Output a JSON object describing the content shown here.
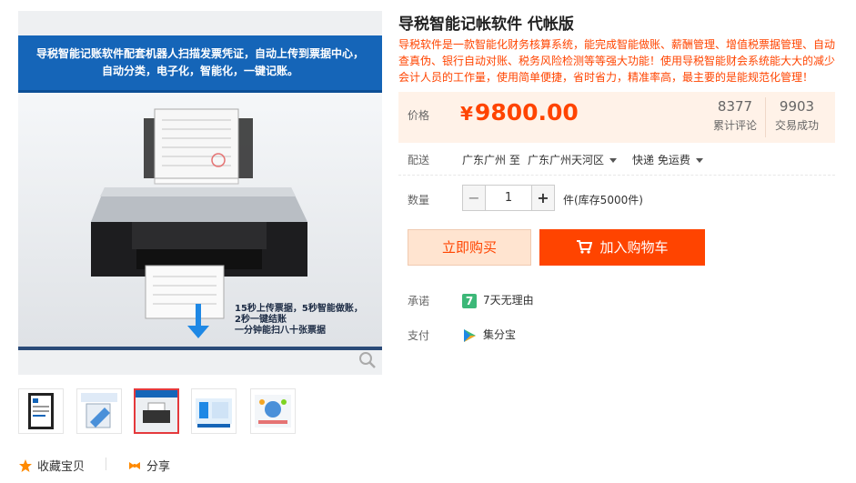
{
  "image": {
    "banner_line1": "导税智能记账软件配套机器人扫描发票凭证，自动上传到票据中心，",
    "banner_line2": "自动分类，电子化，智能化，一键记账。",
    "caption": [
      "15秒上传票据，5秒智能做账，",
      "2秒一键结账",
      "一分钟能扫八十张票据"
    ]
  },
  "thumbnails": [
    "thumb-1",
    "thumb-2",
    "thumb-3",
    "thumb-4",
    "thumb-5"
  ],
  "actions": {
    "favorite_label": "收藏宝贝",
    "share_label": "分享"
  },
  "product": {
    "title": "导税智能记帐软件 代帐版",
    "description": "导税软件是一款智能化财务核算系统，能完成智能做账、薪酬管理、增值税票据管理、自动查真伪、银行自动对账、税务风险检测等等强大功能！使用导税智能财会系统能大大的减少会计人员的工作量，使用简单便捷，省时省力，精准率高，最主要的是能规范化管理！"
  },
  "price": {
    "label": "价格",
    "currency": "¥",
    "value": "9800.00",
    "reviews_count": "8377",
    "reviews_label": "累计评论",
    "deals_count": "9903",
    "deals_label": "交易成功"
  },
  "delivery": {
    "label": "配送",
    "from": "广东广州 至",
    "to": "广东广州天河区",
    "shipping": "快递 免运费"
  },
  "quantity": {
    "label": "数量",
    "minus": "−",
    "value": "1",
    "plus": "+",
    "stock": "件(库存5000件)"
  },
  "buttons": {
    "buy_now": "立即购买",
    "add_to_cart": "加入购物车"
  },
  "promise": {
    "label": "承诺",
    "badge": "7",
    "text": "7天无理由"
  },
  "payment": {
    "label": "支付",
    "text": "集分宝"
  },
  "colors": {
    "accent": "#ff4400",
    "banner": "#1565b8",
    "price_bg": "#fff2e8"
  }
}
